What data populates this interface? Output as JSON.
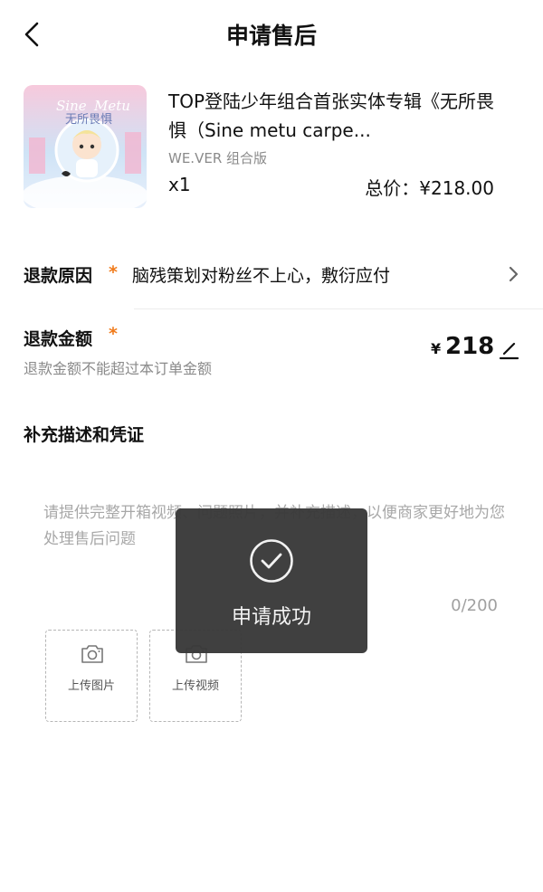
{
  "header": {
    "title": "申请售后"
  },
  "product": {
    "title": "TOP登陆少年组合首张实体专辑《无所畏惧（Sine metu carpe...",
    "spec": "WE.VER 组合版",
    "quantity": "x1",
    "total": "总价：¥218.00",
    "thumb_text": "无所畏惧"
  },
  "refund_reason": {
    "label": "退款原因",
    "required_mark": "*",
    "value": "脑残策划对粉丝不上心，敷衍应付"
  },
  "refund_amount": {
    "label": "退款金额",
    "required_mark": "*",
    "hint": "退款金额不能超过本订单金额",
    "currency": "¥",
    "value": "218"
  },
  "evidence": {
    "title": "补充描述和凭证",
    "placeholder": "请提供完整开箱视频、问题照片，并补充描述，以便商家更好地为您处理售后问题",
    "counter": "0/200",
    "upload_image_label": "上传图片",
    "upload_video_label": "上传视频"
  },
  "toast": {
    "text": "申请成功"
  },
  "colors": {
    "accent_star": "#f07a1a",
    "toast_bg": "#383838"
  }
}
